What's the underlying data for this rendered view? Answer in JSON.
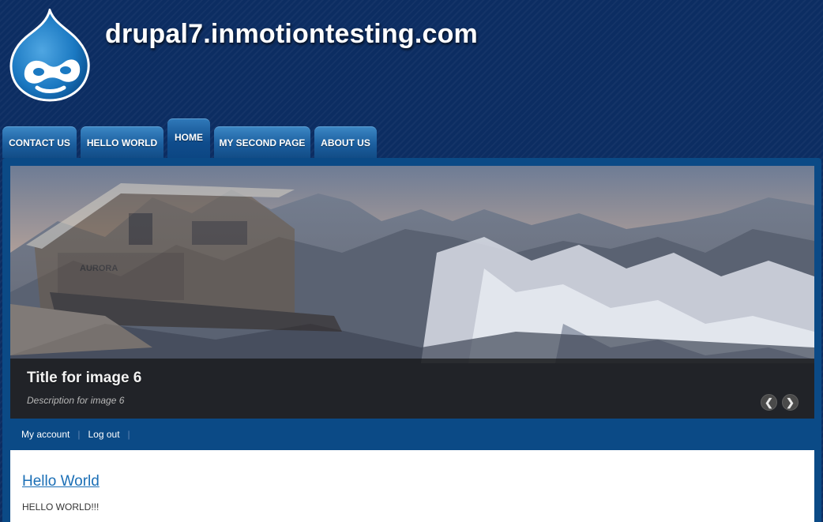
{
  "site": {
    "name": "drupal7.inmotiontesting.com"
  },
  "nav": {
    "tabs": [
      {
        "label": "CONTACT US",
        "active": false
      },
      {
        "label": "HELLO WORLD",
        "active": false
      },
      {
        "label": "HOME",
        "active": true
      },
      {
        "label": "MY SECOND PAGE",
        "active": false
      },
      {
        "label": "ABOUT US",
        "active": false
      }
    ]
  },
  "slideshow": {
    "title": "Title for image 6",
    "description": "Description for image 6",
    "prev_icon": "chevron-left-icon",
    "next_icon": "chevron-right-icon",
    "prev_glyph": "❮",
    "next_glyph": "❯",
    "image_text": "AURORA"
  },
  "secondary_menu": {
    "items": [
      "My account",
      "Log out"
    ]
  },
  "content": {
    "node_title": "Hello World",
    "node_body": "HELLO WORLD!!!"
  },
  "colors": {
    "header_bg": "#0c2d62",
    "panel_bg": "#0b4a86",
    "tab_bg": "#1c5f9f",
    "link": "#1b6fb6"
  }
}
